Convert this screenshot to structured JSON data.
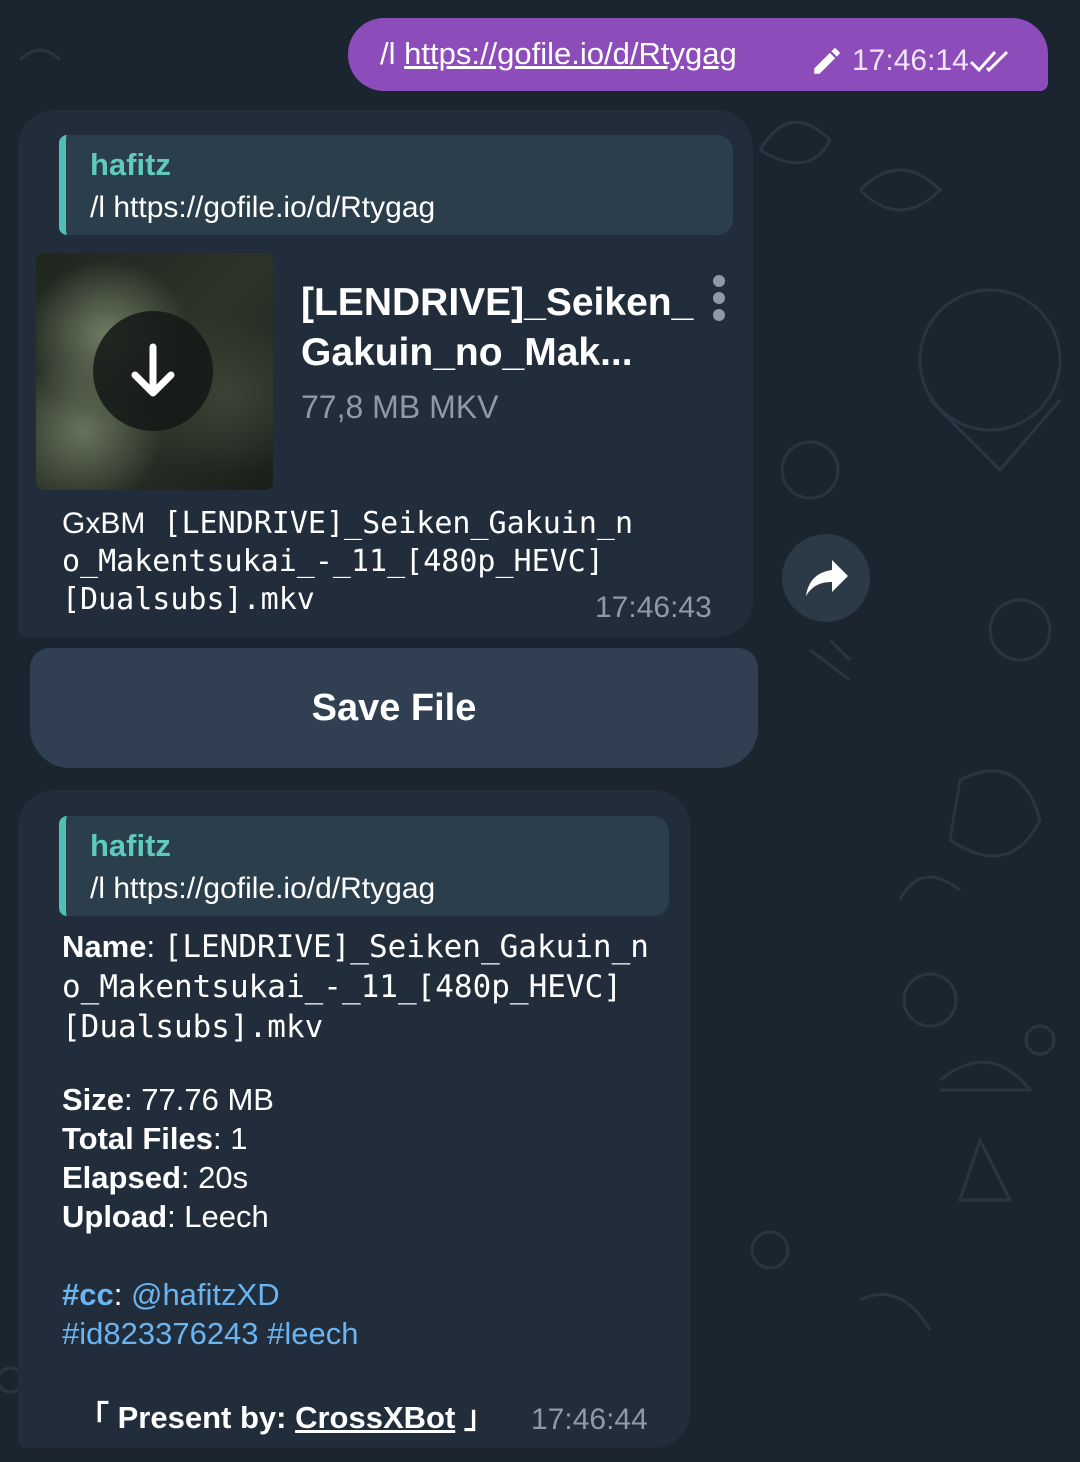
{
  "outgoing": {
    "command": "/l",
    "url": "https://gofile.io/d/Rtygag",
    "time": "17:46:14"
  },
  "file_message": {
    "reply": {
      "name": "hafitz",
      "text": "/l https://gofile.io/d/Rtygag"
    },
    "file_title": "[LENDRIVE]_Seiken_ Gakuin_no_Mak...",
    "file_size_type": "77,8 MB MKV",
    "caption_prefix": "GxBM",
    "caption_line1": "[LENDRIVE]_Seiken_Gakuin_n",
    "caption_line2": "o_Makentsukai_-_11_[480p_HEVC]",
    "caption_line3": "[Dualsubs].mkv",
    "time": "17:46:43"
  },
  "save_button_label": "Save File",
  "info_message": {
    "reply": {
      "name": "hafitz",
      "text": "/l https://gofile.io/d/Rtygag"
    },
    "name_label": "Name",
    "name_line1": "[LENDRIVE]_Seiken_Gakuin_n",
    "name_line2": "o_Makentsukai_-_11_[480p_HEVC]",
    "name_line3": "[Dualsubs].mkv",
    "size_label": "Size",
    "size_value": "77.76 MB",
    "total_files_label": "Total Files",
    "total_files_value": "1",
    "elapsed_label": "Elapsed",
    "elapsed_value": "20s",
    "upload_label": "Upload",
    "upload_value": "Leech",
    "cc_tag": "#cc",
    "cc_user": "@hafitzXD",
    "id_tag": "#id823376243",
    "leech_tag": "#leech",
    "present_open": "「 Present by:",
    "present_link": "CrossXBot",
    "present_close": "」",
    "time": "17:46:44"
  },
  "colors": {
    "background": "#1b2530",
    "outgoing_bubble": "#8c4cba",
    "incoming_bubble": "#212d3b",
    "reply_accent": "#4ec0b6",
    "hashtag": "#6ab4f2"
  }
}
